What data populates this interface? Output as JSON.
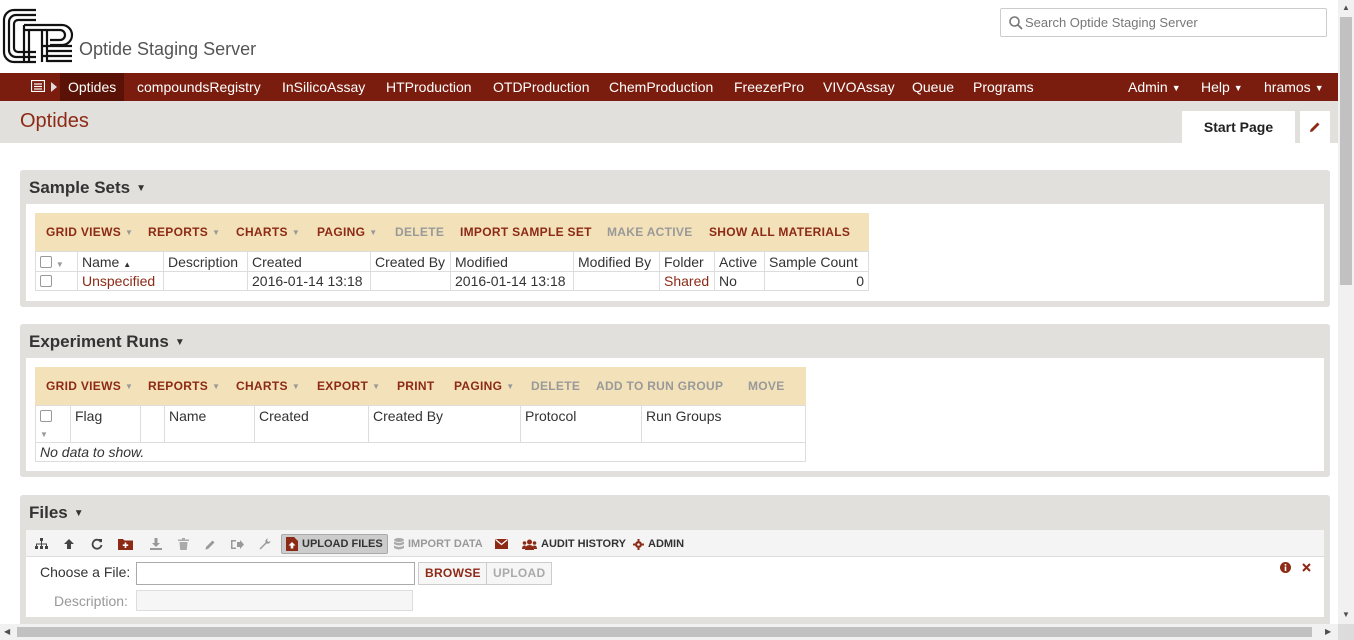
{
  "header": {
    "site_title": "Optide Staging Server",
    "search_placeholder": "Search Optide Staging Server"
  },
  "nav": {
    "items": [
      {
        "label": "Optides",
        "active": true
      },
      {
        "label": "compoundsRegistry"
      },
      {
        "label": "InSilicoAssay"
      },
      {
        "label": "HTProduction"
      },
      {
        "label": "OTDProduction"
      },
      {
        "label": "ChemProduction"
      },
      {
        "label": "FreezerPro"
      },
      {
        "label": "VIVOAssay"
      },
      {
        "label": "Queue"
      },
      {
        "label": "Programs"
      }
    ],
    "right": {
      "admin": "Admin",
      "help": "Help",
      "user": "hramos"
    },
    "colors": {
      "bar": "#7b1d0e",
      "accent_text": "#8d2a16"
    }
  },
  "page": {
    "title": "Optides",
    "tab_start": "Start Page"
  },
  "sample_sets": {
    "title": "Sample Sets",
    "buttons": {
      "grid_views": "GRID VIEWS",
      "reports": "REPORTS",
      "charts": "CHARTS",
      "paging": "PAGING",
      "delete": "DELETE",
      "import_sample_set": "IMPORT SAMPLE SET",
      "make_active": "MAKE ACTIVE",
      "show_all_materials": "SHOW ALL MATERIALS"
    },
    "columns": {
      "name": "Name",
      "description": "Description",
      "created": "Created",
      "created_by": "Created By",
      "modified": "Modified",
      "modified_by": "Modified By",
      "folder": "Folder",
      "active": "Active",
      "sample_count": "Sample Count"
    },
    "rows": [
      {
        "name": "Unspecified",
        "description": "",
        "created": "2016-01-14 13:18",
        "created_by": "",
        "modified": "2016-01-14 13:18",
        "modified_by": "",
        "folder": "Shared",
        "active": "No",
        "sample_count": "0"
      }
    ]
  },
  "experiment_runs": {
    "title": "Experiment Runs",
    "buttons": {
      "grid_views": "GRID VIEWS",
      "reports": "REPORTS",
      "charts": "CHARTS",
      "export": "EXPORT",
      "print": "PRINT",
      "paging": "PAGING",
      "delete": "DELETE",
      "add_to_run_group": "ADD TO RUN GROUP",
      "move": "MOVE"
    },
    "columns": {
      "flag": "Flag",
      "name": "Name",
      "created": "Created",
      "created_by": "Created By",
      "protocol": "Protocol",
      "run_groups": "Run Groups"
    },
    "empty_text": "No data to show."
  },
  "files": {
    "title": "Files",
    "toolbar": {
      "upload_files": "UPLOAD FILES",
      "import_data": "IMPORT DATA",
      "audit_history": "AUDIT HISTORY",
      "admin": "ADMIN"
    },
    "form": {
      "choose_label": "Choose a File:",
      "description_label": "Description:",
      "browse": "BROWSE",
      "upload": "UPLOAD"
    }
  }
}
